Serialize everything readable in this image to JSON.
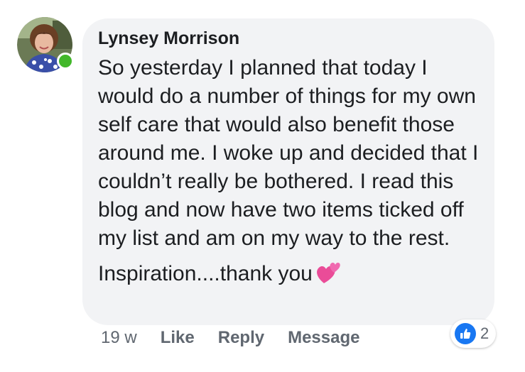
{
  "comment": {
    "author": "Lynsey Morrison",
    "body_paragraph_1": "So yesterday I planned that today I would do a number of things for my own self care that would also benefit those around me. I woke up and decided that I couldn’t really be bothered. I read this blog and now have two items ticked off my list and am on my way to the rest.",
    "body_paragraph_2": "Inspiration....thank you",
    "emoji": "two-hearts-emoji",
    "presence_color": "#42b72a"
  },
  "actions": {
    "timestamp": "19 w",
    "like_label": "Like",
    "reply_label": "Reply",
    "message_label": "Message"
  },
  "reactions": {
    "icon": "thumbs-up-icon",
    "count": "2",
    "color": "#1877f2"
  }
}
